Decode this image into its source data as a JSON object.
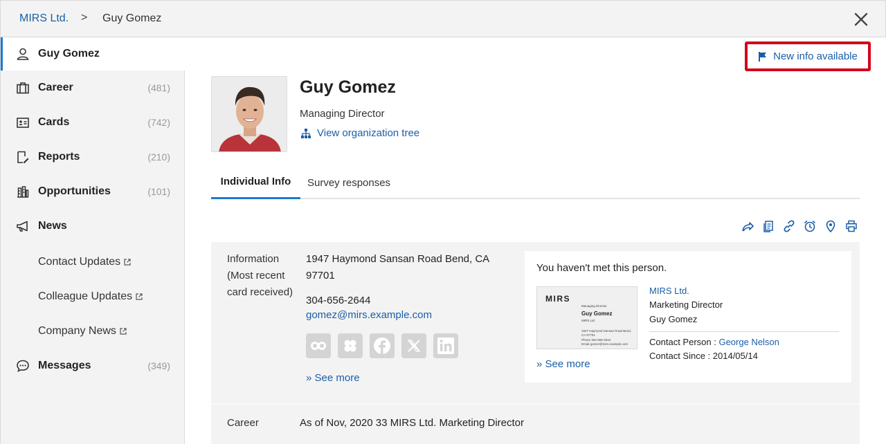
{
  "breadcrumb": {
    "parent": "MIRS Ltd.",
    "separator": ">",
    "current": "Guy Gomez"
  },
  "sidebar": {
    "items": [
      {
        "label": "Guy Gomez",
        "count": "",
        "icon": "person-icon"
      },
      {
        "label": "Career",
        "count": "(481)",
        "icon": "briefcase-icon"
      },
      {
        "label": "Cards",
        "count": "(742)",
        "icon": "id-card-icon"
      },
      {
        "label": "Reports",
        "count": "(210)",
        "icon": "report-edit-icon"
      },
      {
        "label": "Opportunities",
        "count": "(101)",
        "icon": "building-chart-icon"
      },
      {
        "label": "News",
        "count": "",
        "icon": "megaphone-icon"
      },
      {
        "label": "Messages",
        "count": "(349)",
        "icon": "chat-bubble-icon"
      }
    ],
    "news_subitems": [
      {
        "label": "Contact Updates"
      },
      {
        "label": "Colleague Updates"
      },
      {
        "label": "Company News"
      }
    ]
  },
  "main": {
    "new_info_label": "New info available",
    "person": {
      "name": "Guy Gomez",
      "title": "Managing Director",
      "org_tree_link": "View organization tree"
    },
    "tabs": [
      {
        "label": "Individual Info",
        "active": true
      },
      {
        "label": "Survey responses",
        "active": false
      }
    ],
    "info": {
      "label": "Information (Most recent card received)",
      "address": "1947 Haymond Sansan Road Bend, CA 97701",
      "phone": "304-656-2644",
      "email": "gomez@mirs.example.com",
      "see_more": "» See more"
    },
    "card": {
      "not_met": "You haven't met this person.",
      "image": {
        "brand": "MIRS",
        "role": "Managing Director",
        "name": "Guy Gomez",
        "company": "MIRS Ltd.",
        "addr1": "1947 Haymond Sansan Road Bend,",
        "addr2": "CA 97701",
        "phone": "Phone 304-656-2644",
        "email": "Email gomez@mirs.example.com"
      },
      "see_more": "» See more",
      "company": "MIRS Ltd.",
      "role": "Marketing Director",
      "name": "Guy Gomez",
      "contact_person_label": "Contact Person : ",
      "contact_person": "George Nelson",
      "contact_since": "Contact Since : 2014/05/14"
    },
    "career": {
      "label": "Career",
      "value": "As of Nov, 2020 33 MIRS Ltd. Marketing Director"
    }
  },
  "colors": {
    "accent": "#1a7ad0",
    "link": "#1a5ea8",
    "highlight_border": "#d0021b"
  }
}
